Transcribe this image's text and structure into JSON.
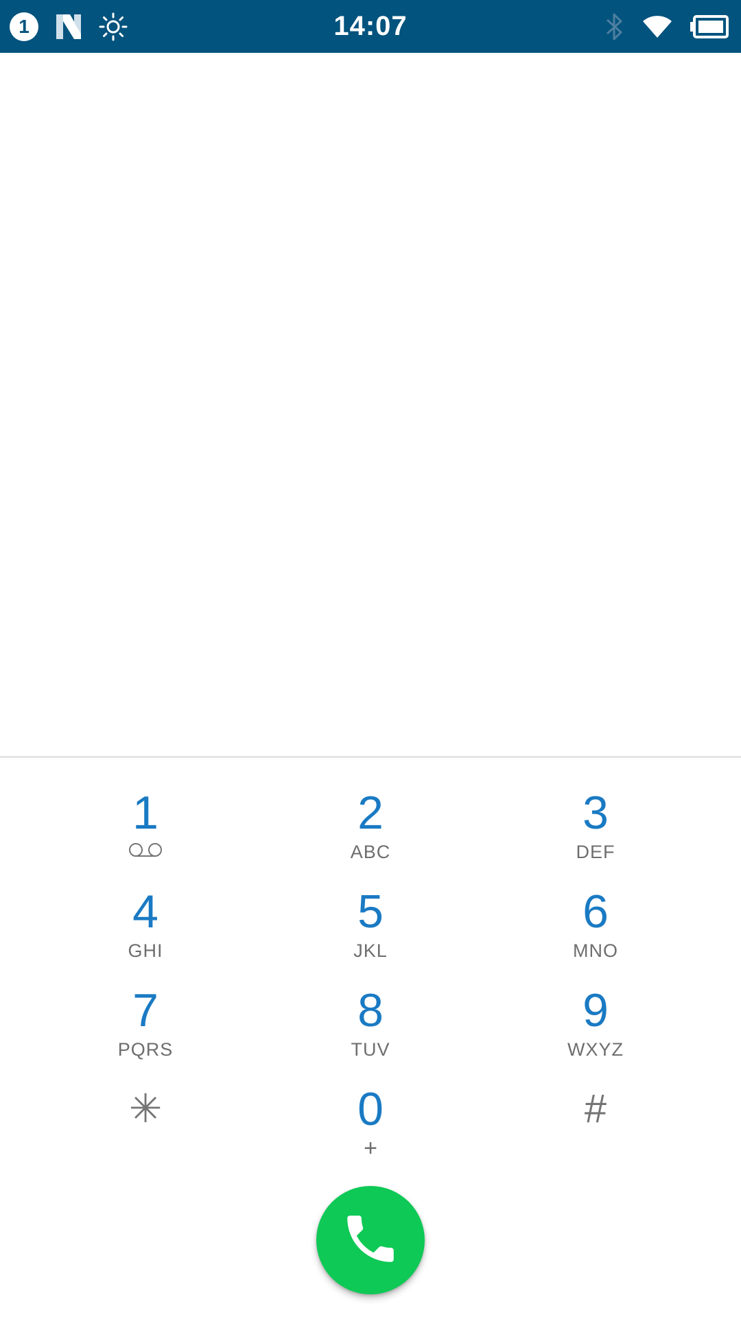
{
  "status_bar": {
    "notification_count": "1",
    "time": "14:07",
    "icons": [
      "n-icon",
      "brightness-icon",
      "bluetooth-icon",
      "wifi-icon",
      "battery-icon"
    ]
  },
  "colors": {
    "status_bar": "#02537e",
    "digit": "#1a7ac3",
    "letters": "#6e6e6e",
    "call_button": "#0ec955"
  },
  "dialpad": {
    "keys": [
      {
        "digit": "1",
        "letters": "",
        "sub_icon": "voicemail-icon"
      },
      {
        "digit": "2",
        "letters": "ABC"
      },
      {
        "digit": "3",
        "letters": "DEF"
      },
      {
        "digit": "4",
        "letters": "GHI"
      },
      {
        "digit": "5",
        "letters": "JKL"
      },
      {
        "digit": "6",
        "letters": "MNO"
      },
      {
        "digit": "7",
        "letters": "PQRS"
      },
      {
        "digit": "8",
        "letters": "TUV"
      },
      {
        "digit": "9",
        "letters": "WXYZ"
      },
      {
        "digit": "✳",
        "letters": ""
      },
      {
        "digit": "0",
        "letters": "+"
      },
      {
        "digit": "#",
        "letters": ""
      }
    ]
  },
  "call_button": {
    "icon": "phone-icon"
  }
}
